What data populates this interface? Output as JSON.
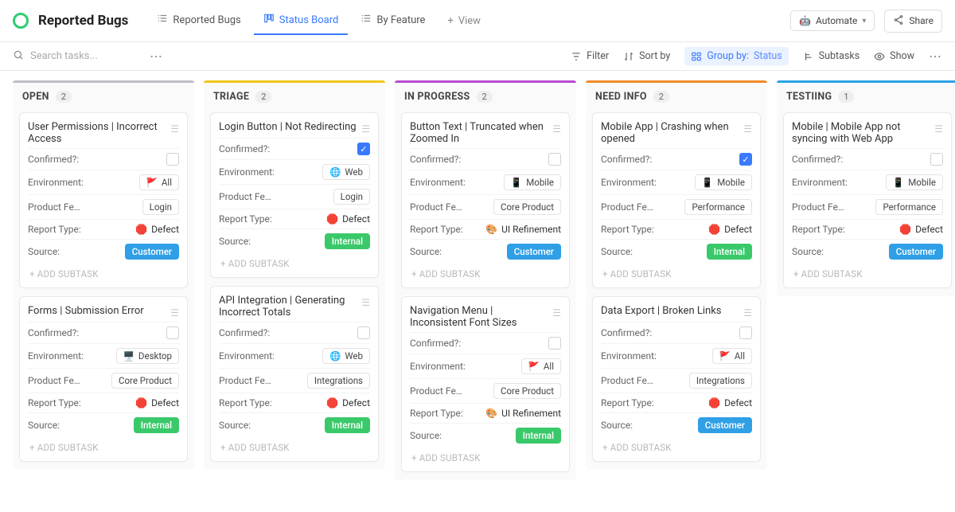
{
  "header": {
    "title": "Reported Bugs",
    "tabs": [
      {
        "label": "Reported Bugs",
        "icon": "list"
      },
      {
        "label": "Status Board",
        "icon": "board",
        "active": true
      },
      {
        "label": "By Feature",
        "icon": "list"
      },
      {
        "label": "View",
        "icon": "plus",
        "ghost": true
      }
    ],
    "automate": "Automate",
    "share": "Share"
  },
  "toolbar": {
    "search_placeholder": "Search tasks...",
    "filter": "Filter",
    "sort": "Sort by",
    "group_label": "Group by:",
    "group_value": "Status",
    "subtasks": "Subtasks",
    "show": "Show"
  },
  "add_subtask_label": "+ ADD SUBTASK",
  "field_labels": {
    "confirmed": "Confirmed?:",
    "environment": "Environment:",
    "product_feature": "Product Fe…",
    "report_type": "Report Type:",
    "source": "Source:"
  },
  "columns": [
    {
      "title": "OPEN",
      "count": "2",
      "color": "#bdbdc4",
      "cards": [
        {
          "title": "User Permissions | Incorrect Access",
          "confirmed": false,
          "environment": {
            "emoji": "🚩",
            "label": "All"
          },
          "product_feature": "Login",
          "report_type": {
            "emoji": "🛑",
            "label": "Defect"
          },
          "source": {
            "label": "Customer",
            "cls": "b-customer"
          }
        },
        {
          "title": "Forms | Submission Error",
          "confirmed": false,
          "environment": {
            "emoji": "🖥️",
            "label": "Desktop"
          },
          "product_feature": "Core Product",
          "report_type": {
            "emoji": "🛑",
            "label": "Defect"
          },
          "source": {
            "label": "Internal",
            "cls": "b-internal"
          }
        }
      ]
    },
    {
      "title": "TRIAGE",
      "count": "2",
      "color": "#f4c41c",
      "cards": [
        {
          "title": "Login Button | Not Redirecting",
          "confirmed": true,
          "environment": {
            "emoji": "🌐",
            "label": "Web"
          },
          "product_feature": "Login",
          "report_type": {
            "emoji": "🛑",
            "label": "Defect"
          },
          "source": {
            "label": "Internal",
            "cls": "b-internal"
          }
        },
        {
          "title": "API Integration | Generating Incorrect Totals",
          "confirmed": false,
          "environment": {
            "emoji": "🌐",
            "label": "Web"
          },
          "product_feature": "Integrations",
          "report_type": {
            "emoji": "🛑",
            "label": "Defect"
          },
          "source": {
            "label": "Internal",
            "cls": "b-internal"
          }
        }
      ]
    },
    {
      "title": "IN PROGRESS",
      "count": "2",
      "color": "#b84bd1",
      "cards": [
        {
          "title": "Button Text | Truncated when Zoomed In",
          "confirmed": false,
          "environment": {
            "emoji": "📱",
            "label": "Mobile"
          },
          "product_feature": "Core Product",
          "report_type": {
            "emoji": "🎨",
            "label": "UI Refinement"
          },
          "source": {
            "label": "Customer",
            "cls": "b-customer"
          }
        },
        {
          "title": "Navigation Menu | Inconsistent Font Sizes",
          "confirmed": false,
          "environment": {
            "emoji": "🚩",
            "label": "All"
          },
          "product_feature": "Core Product",
          "report_type": {
            "emoji": "🎨",
            "label": "UI Refinement"
          },
          "source": {
            "label": "Internal",
            "cls": "b-internal"
          }
        }
      ]
    },
    {
      "title": "NEED INFO",
      "count": "2",
      "color": "#f08b2a",
      "cards": [
        {
          "title": "Mobile App | Crashing when opened",
          "confirmed": true,
          "environment": {
            "emoji": "📱",
            "label": "Mobile"
          },
          "product_feature": "Performance",
          "report_type": {
            "emoji": "🛑",
            "label": "Defect"
          },
          "source": {
            "label": "Internal",
            "cls": "b-internal"
          }
        },
        {
          "title": "Data Export | Broken Links",
          "confirmed": false,
          "environment": {
            "emoji": "🚩",
            "label": "All"
          },
          "product_feature": "Integrations",
          "report_type": {
            "emoji": "🛑",
            "label": "Defect"
          },
          "source": {
            "label": "Customer",
            "cls": "b-customer"
          }
        }
      ]
    },
    {
      "title": "TESTIING",
      "count": "1",
      "color": "#2aa3e6",
      "cards": [
        {
          "title": "Mobile | Mobile App not syncing with Web App",
          "confirmed": false,
          "environment": {
            "emoji": "📱",
            "label": "Mobile"
          },
          "product_feature": "Performance",
          "report_type": {
            "emoji": "🛑",
            "label": "Defect"
          },
          "source": {
            "label": "Customer",
            "cls": "b-customer"
          }
        }
      ]
    }
  ]
}
